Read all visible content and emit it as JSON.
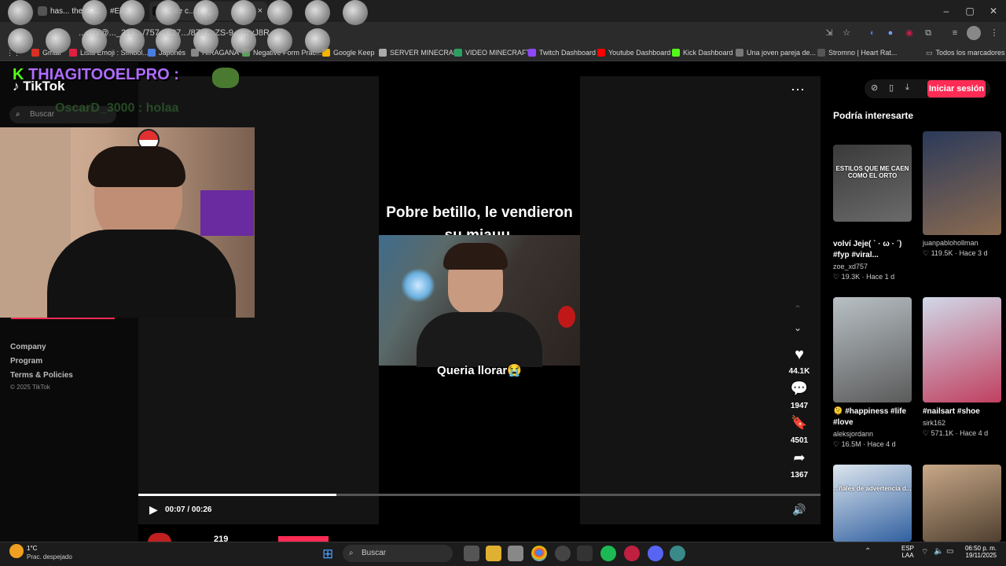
{
  "browser": {
    "tabs": [
      {
        "label": "has... the de..."
      },
      {
        "label": "#El/..."
      },
      {
        "label": "... de c... (@_..."
      }
    ],
    "close_tab_glyph": "×",
    "url": "...om/@..._219.../757...627.../87_r...ZS-9...qzyJ8R",
    "bookmarks": [
      {
        "label": "Gmail",
        "color": "#d93025"
      },
      {
        "label": "Lista Emoji : Símbol...",
        "color": "#e02040"
      },
      {
        "label": "Japonés",
        "color": "#4a7de0"
      },
      {
        "label": "HIRAGANA",
        "color": "#888888"
      },
      {
        "label": "Negative Form Prac...",
        "color": "#5aa05a"
      },
      {
        "label": "Google Keep",
        "color": "#f4b400"
      },
      {
        "label": "SERVER MINECRAFT",
        "color": "#aaaaaa"
      },
      {
        "label": "VIDEO MINECRAFT",
        "color": "#2aa060"
      },
      {
        "label": "Twitch Dashboard",
        "color": "#9146ff"
      },
      {
        "label": "Youtube Dashboard",
        "color": "#ff0000"
      },
      {
        "label": "Kick Dashboard",
        "color": "#53fc18"
      },
      {
        "label": "Una joven pareja de...",
        "color": "#777777"
      },
      {
        "label": "Stromno | Heart Rat...",
        "color": "#555555"
      }
    ],
    "all_bookmarks": "Todos los marcadores"
  },
  "tiktok": {
    "logo": "TikTok",
    "search_placeholder": "Buscar",
    "nav_links": [
      "Company",
      "Program",
      "Terms & Policies"
    ],
    "copyright": "© 2025 TikTok",
    "login_label": "Iniciar sesión",
    "suggest_title": "Podría interesarte"
  },
  "stream_overlay": {
    "streamer_name": "THIAGITOOELPRO :",
    "chat_user": "OscarD_3000",
    "chat_text": ": holaa"
  },
  "video": {
    "caption_top": "Pobre betillo, le vendieron su miauu.",
    "caption_bottom": "Queria llorar😭",
    "likes": "44.1K",
    "comments": "1947",
    "saves": "4501",
    "shares": "1367",
    "time": "00:07 / 00:26",
    "progress": 0.29,
    "bottom_count": "219"
  },
  "suggestions": [
    {
      "thumb_text": "ESTILOS QUE ME CAEN COMO EL ORTO",
      "title": "volví Jeje( ` · ω · ´) #fyp #viral...",
      "user": "zoe_xd757",
      "likes": "19.3K",
      "age": "Hace 1 d",
      "c1": "#3a3a3a",
      "c2": "#6b6b6b"
    },
    {
      "thumb_text": "",
      "title": "",
      "user": "juanpablohollman",
      "likes": "119.5K",
      "age": "Hace 3 d",
      "c1": "#2b3a5a",
      "c2": "#8a6a50"
    },
    {
      "thumb_text": "",
      "title": "🫠 #happiness #life #love",
      "user": "aleksjordann",
      "likes": "16.5M",
      "age": "Hace 4 d",
      "c1": "#b8c0c4",
      "c2": "#5a5a5a"
    },
    {
      "thumb_text": "",
      "title": "#nailsart #shoe",
      "user": "sirk162",
      "likes": "571.1K",
      "age": "Hace 4 d",
      "c1": "#d0d8e8",
      "c2": "#c04060"
    },
    {
      "thumb_text": "...ñales de advertencia d...",
      "c1": "#dde6ee",
      "c2": "#3060a0"
    },
    {
      "thumb_text": "",
      "c1": "#c8a888",
      "c2": "#504030"
    }
  ],
  "taskbar": {
    "temp": "1°C",
    "weather": "Prac. despejado",
    "search": "Buscar",
    "lang": "ESP",
    "lang2": "LAA",
    "time": "06:50 p. m.",
    "date": "19/11/2025"
  },
  "colors": {
    "accent": "#fe2c55",
    "streamer": "#b06cff"
  }
}
